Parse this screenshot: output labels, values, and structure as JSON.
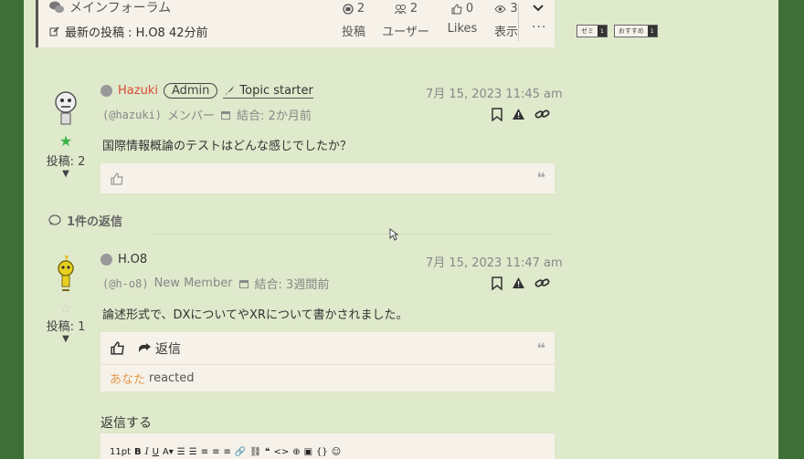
{
  "forum": {
    "name": "メインフォーラム",
    "latest": "最新の投稿 : H.O8 42分前",
    "stats": [
      {
        "value": "2",
        "label": "投稿"
      },
      {
        "value": "2",
        "label": "ユーザー"
      },
      {
        "value": "0",
        "label": "Likes"
      },
      {
        "value": "3",
        "label": "表示"
      }
    ]
  },
  "tags": [
    {
      "label": "ゼミ",
      "count": "1"
    },
    {
      "label": "おすすめ",
      "count": "1"
    }
  ],
  "post1": {
    "author": "Hazuki",
    "role_badge": "Admin",
    "starter": "Topic starter",
    "handle": "(@hazuki)",
    "member_type": "メンバー",
    "joined": "結合: 2か月前",
    "datetime": "7月 15, 2023 11:45 am",
    "post_count": "投稿: 2",
    "content": "国際情報概論のテストはどんな感じでしたか？",
    "author_color": "#d94b35"
  },
  "replies_count": "1件の返信",
  "post2": {
    "author": "H.O8",
    "handle": "(@h-o8)",
    "member_type": "New Member",
    "joined": "結合: 3週間前",
    "datetime": "7月 15, 2023 11:47 am",
    "post_count": "投稿: 1",
    "content": "論述形式で、DXについてやXRについて書かされました。",
    "reply_label": "返信",
    "reacted_you": "あなた",
    "reacted_text": "reacted"
  },
  "reply_form": {
    "title": "返信する",
    "font_size": "11pt"
  }
}
